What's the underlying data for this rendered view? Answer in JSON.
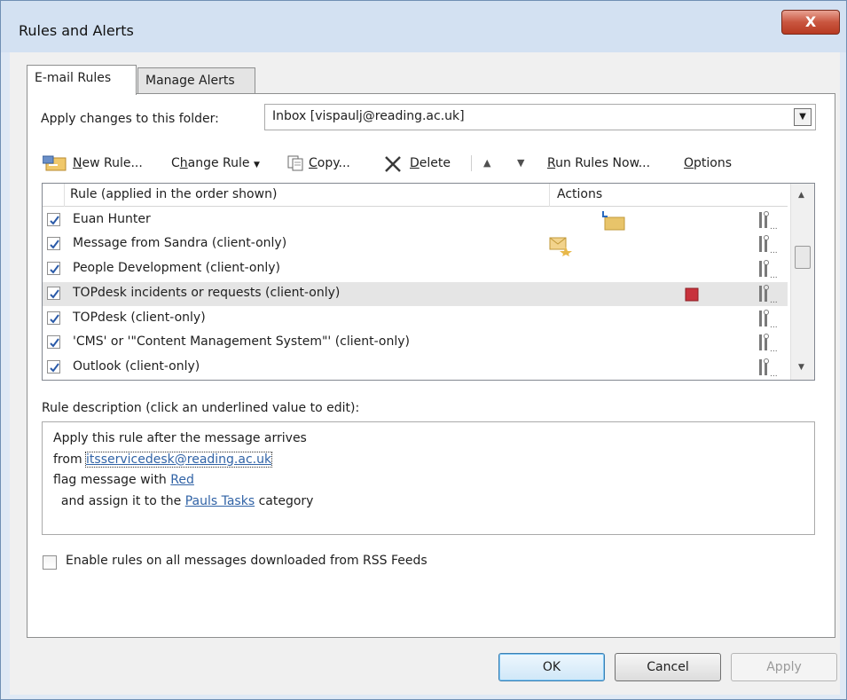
{
  "window": {
    "title": "Rules and Alerts",
    "close_glyph": "X"
  },
  "tabs": [
    {
      "label": "E-mail Rules",
      "active": true
    },
    {
      "label": "Manage Alerts",
      "active": false
    }
  ],
  "folder": {
    "label": "Apply changes to this folder:",
    "value": "Inbox [vispaulj@reading.ac.uk]"
  },
  "toolbar": {
    "new_rule": {
      "mnemonic": "N",
      "rest": "ew Rule..."
    },
    "change_rule": {
      "before": "C",
      "mnemonic": "h",
      "rest": "ange Rule"
    },
    "copy": {
      "mnemonic": "C",
      "rest": "opy..."
    },
    "delete": {
      "mnemonic": "D",
      "rest": "elete"
    },
    "run_rules": {
      "mnemonic": "R",
      "rest": "un Rules Now..."
    },
    "options": {
      "mnemonic": "O",
      "rest": "ptions"
    }
  },
  "rules_list": {
    "col_rule": "Rule (applied in the order shown)",
    "col_actions": "Actions",
    "rows": [
      {
        "label": "Euan Hunter",
        "checked": true,
        "action_icon": "move-to-folder-icon"
      },
      {
        "label": "Message from Sandra  (client-only)",
        "checked": true,
        "action_icon": "new-mail-alert-icon"
      },
      {
        "label": "People Development  (client-only)",
        "checked": true,
        "action_icon": ""
      },
      {
        "label": "TOPdesk incidents or requests  (client-only)",
        "checked": true,
        "action_icon": "category-square-icon",
        "selected": true
      },
      {
        "label": "TOPdesk  (client-only)",
        "checked": true,
        "action_icon": ""
      },
      {
        "label": "'CMS' or '\"Content Management System\"'  (client-only)",
        "checked": true,
        "action_icon": ""
      },
      {
        "label": "Outlook  (client-only)",
        "checked": true,
        "action_icon": ""
      }
    ]
  },
  "description": {
    "label": "Rule description (click an underlined value to edit):",
    "line1": "Apply this rule after the message arrives",
    "line2_prefix": "from ",
    "line2_link": "itsservicedesk@reading.ac.uk",
    "line3_prefix": "flag message with ",
    "line3_link": "Red",
    "line4_prefix": "  and assign it to the ",
    "line4_link": "Pauls Tasks",
    "line4_suffix": " category"
  },
  "rss": {
    "label": "Enable rules on all messages downloaded from RSS Feeds",
    "checked": false
  },
  "buttons": {
    "ok": "OK",
    "cancel": "Cancel",
    "apply": "Apply"
  },
  "colors": {
    "category_red": "#c8323c",
    "link_blue": "#3163a6",
    "folder_yellow": "#e8c46a"
  }
}
